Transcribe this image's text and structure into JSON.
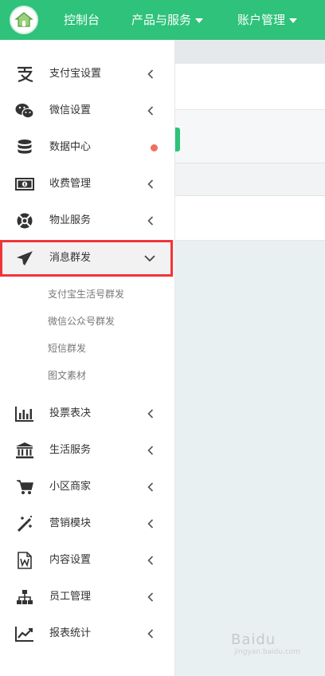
{
  "header": {
    "nav": [
      {
        "label": "控制台",
        "has_caret": false
      },
      {
        "label": "产品与服务",
        "has_caret": true
      },
      {
        "label": "账户管理",
        "has_caret": true
      }
    ]
  },
  "sidebar": {
    "items": [
      {
        "label": "支付宝设置",
        "icon": "alipay-icon",
        "expandable": true
      },
      {
        "label": "微信设置",
        "icon": "wechat-icon",
        "expandable": true
      },
      {
        "label": "数据中心",
        "icon": "database-icon",
        "expandable": false,
        "badge_color": "#f07060"
      },
      {
        "label": "收费管理",
        "icon": "money-icon",
        "expandable": true
      },
      {
        "label": "物业服务",
        "icon": "lifebuoy-icon",
        "expandable": true
      },
      {
        "label": "消息群发",
        "icon": "paper-plane-icon",
        "expandable": true,
        "expanded": true
      },
      {
        "label": "投票表决",
        "icon": "bar-chart-icon",
        "expandable": true
      },
      {
        "label": "生活服务",
        "icon": "bank-icon",
        "expandable": true
      },
      {
        "label": "小区商家",
        "icon": "cart-icon",
        "expandable": true
      },
      {
        "label": "营销模块",
        "icon": "magic-wand-icon",
        "expandable": true
      },
      {
        "label": "内容设置",
        "icon": "word-file-icon",
        "expandable": true
      },
      {
        "label": "员工管理",
        "icon": "sitemap-icon",
        "expandable": true
      },
      {
        "label": "报表统计",
        "icon": "line-chart-icon",
        "expandable": true
      }
    ],
    "submenu": [
      "支付宝生活号群发",
      "微信公众号群发",
      "短信群发",
      "图文素材"
    ]
  },
  "colors": {
    "brand": "#2ec27a",
    "highlight": "#f0353a"
  },
  "watermark": {
    "text": "Baidu",
    "sub": "jingyan.baidu.com"
  }
}
